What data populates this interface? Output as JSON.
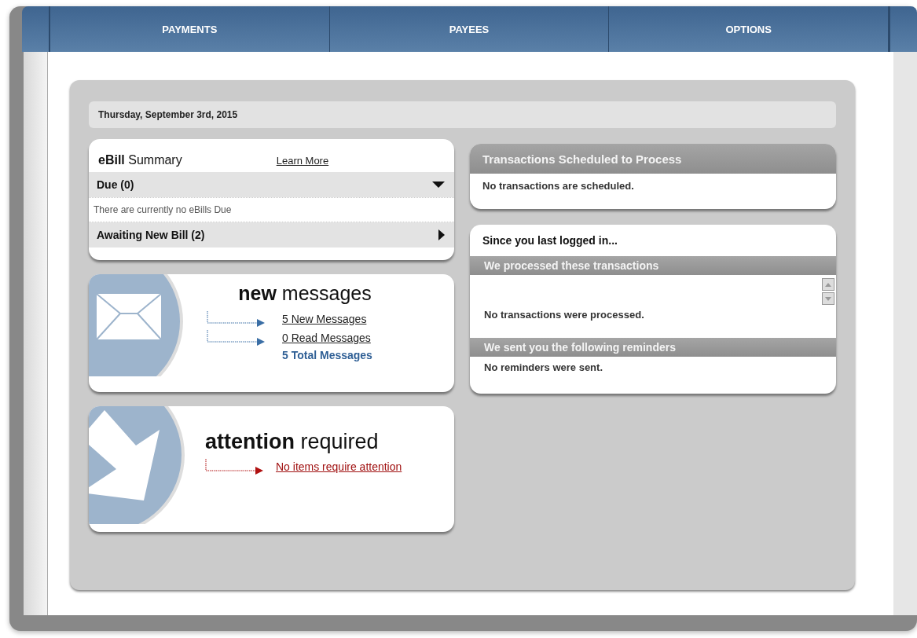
{
  "tabs": [
    {
      "label": "PAYMENTS",
      "selected": false
    },
    {
      "label": "PAYEES",
      "selected": false
    },
    {
      "label": "OPTIONS",
      "selected": false
    }
  ],
  "date": "Thursday, September 3rd, 2015",
  "ebill_summary": {
    "title": "**eBill** Summary",
    "link": "Learn More",
    "sections": [
      {
        "label": "Due (0)",
        "expanded": true,
        "message": "There are currently no eBills Due"
      },
      {
        "label": "Awaiting New Bill (2)",
        "expanded": false
      }
    ]
  },
  "messages": {
    "title": "**new** messages",
    "links": [
      {
        "label": "5 New Messages"
      },
      {
        "label": "0 Read Messages"
      }
    ],
    "total": "5 Total Messages"
  },
  "attention": {
    "title": "**attention** required",
    "link": "No items require attention"
  },
  "scheduled": {
    "title": "Transactions Scheduled to Process",
    "message": "No transactions are scheduled."
  },
  "since_login": {
    "title": "Since you last logged in...",
    "sections": [
      {
        "title": "We processed these transactions",
        "message": "No transactions were processed.",
        "scrollable": true
      },
      {
        "title": "We sent you the following reminders",
        "message": "No reminders were sent.",
        "scrollable": false
      }
    ]
  }
}
